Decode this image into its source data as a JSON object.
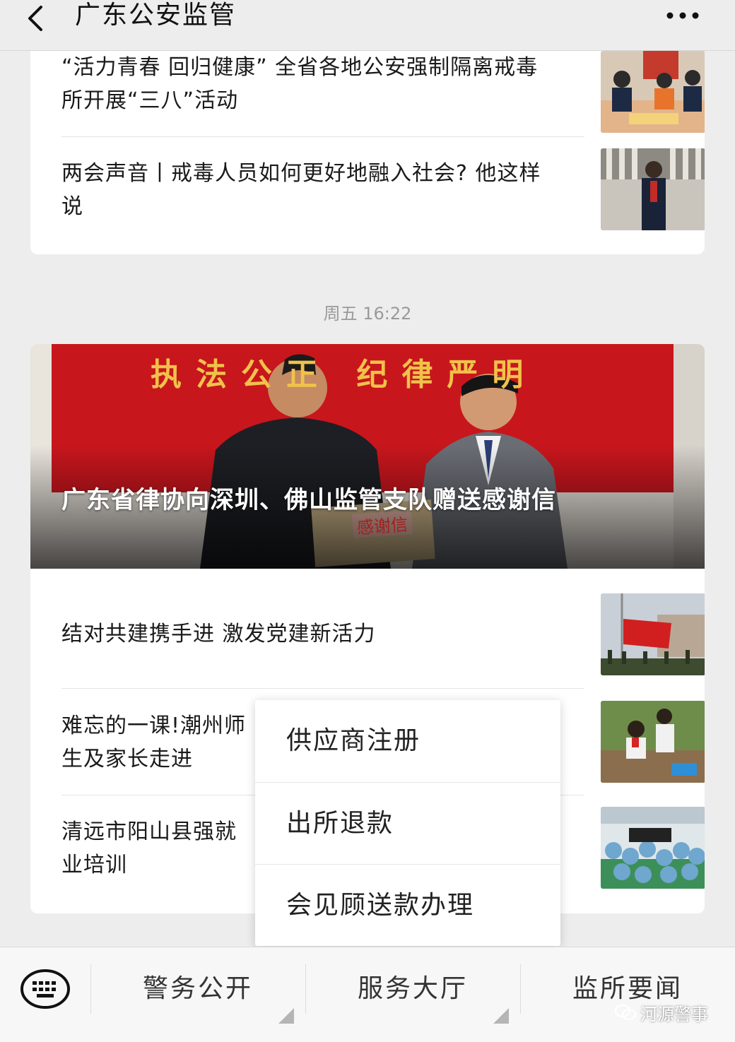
{
  "header": {
    "title": "广东公安监管",
    "back_icon": "chevron-left-icon",
    "more_icon": "more-dots-icon"
  },
  "articles_top": [
    {
      "title": "“活力青春 回归健康” 全省各地公安强制隔离戒毒所开展“三八”活动"
    },
    {
      "title": "两会声音丨戒毒人员如何更好地融入社会? 他这样说"
    }
  ],
  "timestamp": "周五 16:22",
  "hero": {
    "title": "广东省律协向深圳、佛山监管支队赠送感谢信",
    "banner_text": "执法公正 纪律严明",
    "envelope_text": "感谢信"
  },
  "articles_bottom": [
    {
      "title": "结对共建携手进 激发党建新活力"
    },
    {
      "title": "难忘的一课!潮州师生及家长走进"
    },
    {
      "title": "清远市阳山县强就业培训"
    }
  ],
  "popup_menu": {
    "items": [
      "供应商注册",
      "出所退款",
      "会见顾送款办理"
    ]
  },
  "bottom_menu": {
    "keyboard_icon": "keyboard-icon",
    "tabs": [
      "警务公开",
      "服务大厅",
      "监所要闻"
    ]
  },
  "watermark": "河源警事",
  "colors": {
    "background": "#ededed",
    "card": "#ffffff",
    "banner_red": "#c8161d",
    "gold_text": "#f0c24a"
  }
}
